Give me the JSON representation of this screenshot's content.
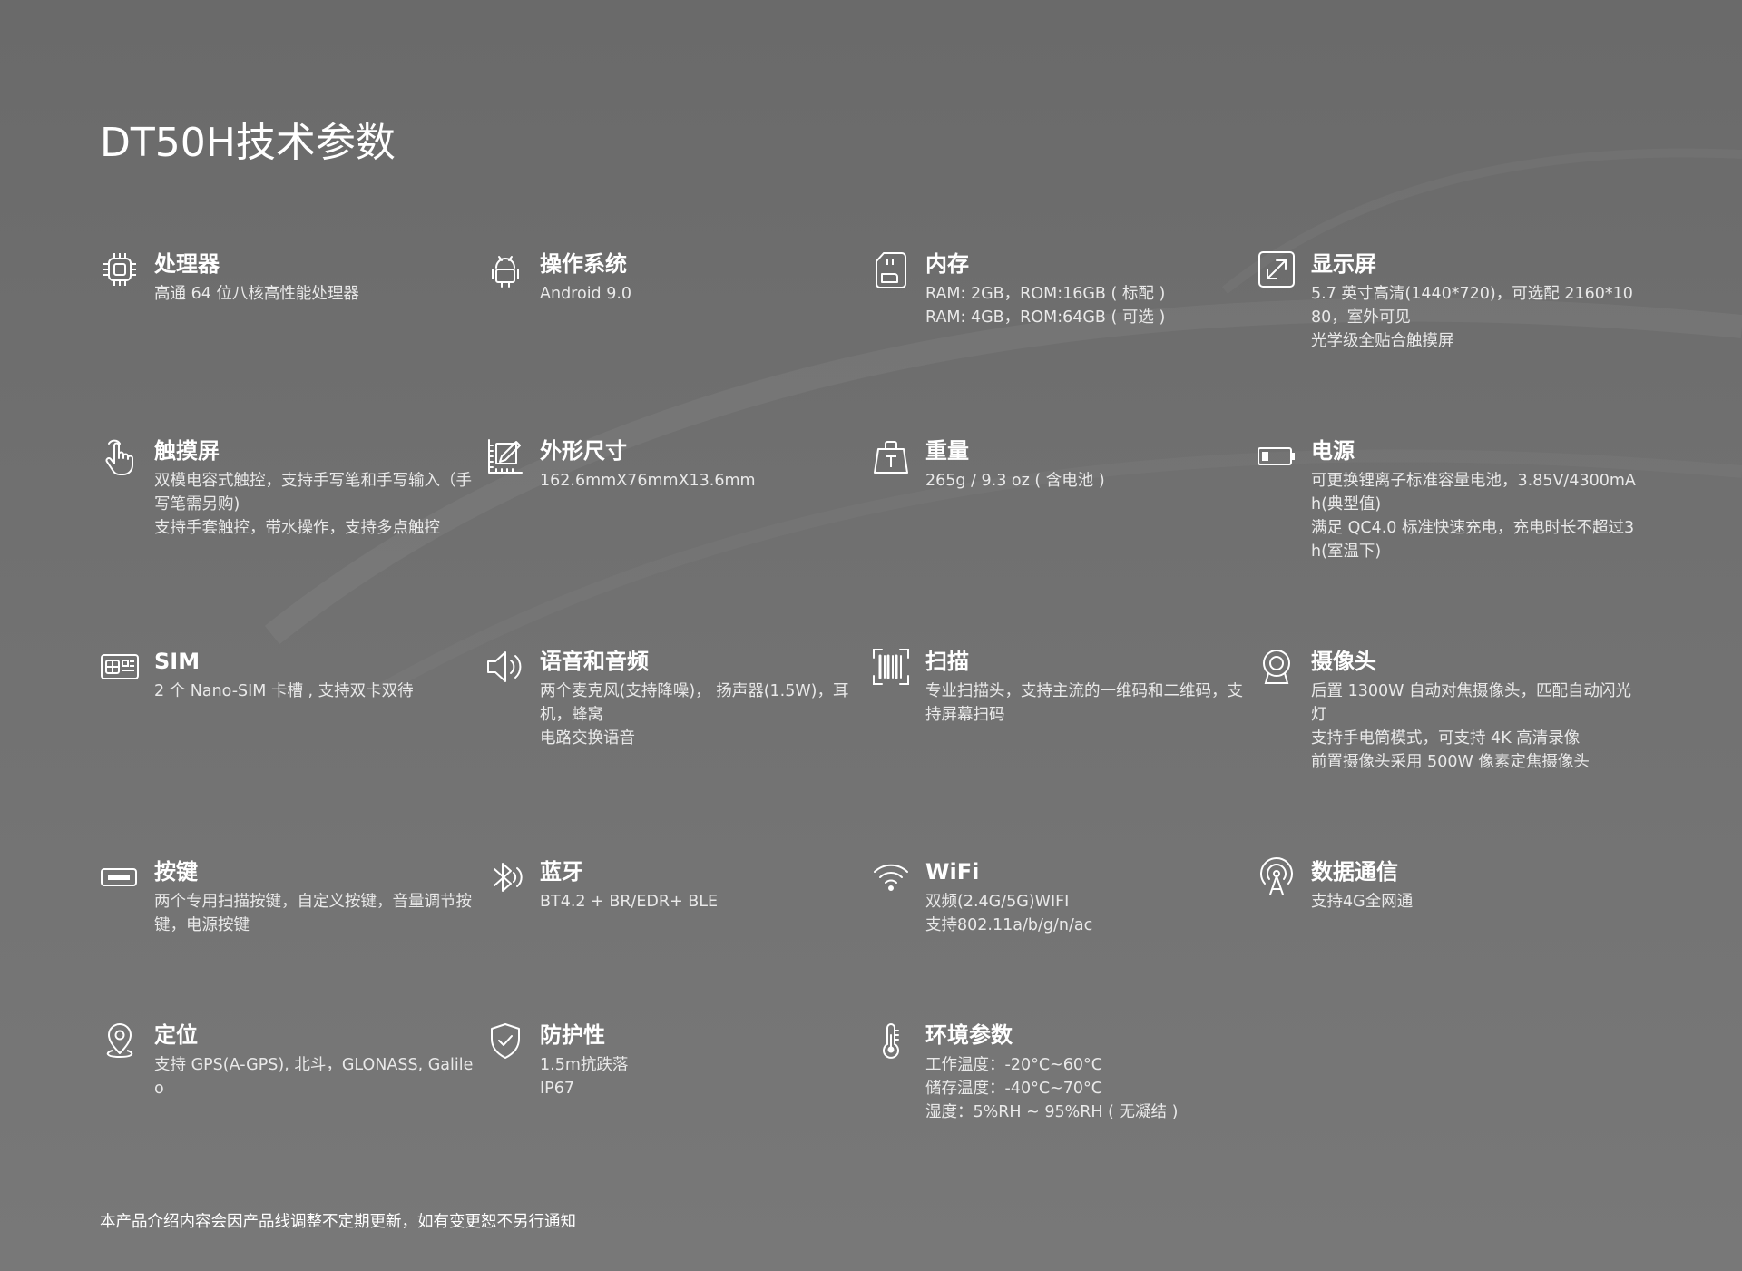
{
  "page": {
    "title": "DT50H技术参数",
    "footer": "本产品介绍内容会因产品线调整不定期更新，如有变更恕不另行通知"
  },
  "specs": [
    {
      "title": "处理器",
      "icon": "chip-icon",
      "lines": [
        "高通 64 位八核高性能处理器"
      ]
    },
    {
      "title": "操作系统",
      "icon": "android-icon",
      "lines": [
        "Android 9.0"
      ]
    },
    {
      "title": "内存",
      "icon": "sd-card-icon",
      "lines": [
        "RAM: 2GB，ROM:16GB ( 标配 )",
        "RAM: 4GB，ROM:64GB ( 可选 )"
      ]
    },
    {
      "title": "显示屏",
      "icon": "expand-screen-icon",
      "lines": [
        "5.7 英寸高清(1440*720)，可选配 2160*1080，室外可见",
        "光学级全贴合触摸屏"
      ]
    },
    {
      "title": "触摸屏",
      "icon": "touch-hand-icon",
      "lines": [
        "双模电容式触控，支持手写笔和手写输入（手写笔需另购)",
        "支持手套触控，带水操作，支持多点触控"
      ]
    },
    {
      "title": "外形尺寸",
      "icon": "ruler-pencil-icon",
      "lines": [
        "162.6mmX76mmX13.6mm"
      ]
    },
    {
      "title": "重量",
      "icon": "weight-icon",
      "lines": [
        "265g / 9.3 oz ( 含电池 )"
      ]
    },
    {
      "title": "电源",
      "icon": "battery-icon",
      "lines": [
        "可更换锂离子标准容量电池，3.85V/4300mAh(典型值)",
        "满足 QC4.0 标准快速充电，充电时长不超过3h(室温下)"
      ]
    },
    {
      "title": "SIM",
      "icon": "sim-card-icon",
      "lines": [
        "2 个 Nano-SIM 卡槽 , 支持双卡双待"
      ]
    },
    {
      "title": "语音和音频",
      "icon": "speaker-icon",
      "lines": [
        "两个麦克风(支持降噪)， 扬声器(1.5W)，耳机，蜂窝",
        "电路交换语音"
      ]
    },
    {
      "title": "扫描",
      "icon": "barcode-scan-icon",
      "lines": [
        "专业扫描头，支持主流的一维码和二维码，支持屏幕扫码"
      ]
    },
    {
      "title": "摄像头",
      "icon": "camera-icon",
      "lines": [
        "后置 1300W 自动对焦摄像头，匹配自动闪光灯",
        "支持手电筒模式，可支持 4K 高清录像",
        "前置摄像头采用 500W 像素定焦摄像头"
      ]
    },
    {
      "title": "按键",
      "icon": "key-button-icon",
      "lines": [
        "两个专用扫描按键，自定义按键，音量调节按键，电源按键"
      ]
    },
    {
      "title": "蓝牙",
      "icon": "bluetooth-icon",
      "lines": [
        "BT4.2 + BR/EDR+ BLE"
      ]
    },
    {
      "title": "WiFi",
      "icon": "wifi-icon",
      "lines": [
        "双频(2.4G/5G)WIFI",
        "支持802.11a/b/g/n/ac"
      ]
    },
    {
      "title": "数据通信",
      "icon": "signal-tower-icon",
      "lines": [
        "支持4G全网通"
      ]
    },
    {
      "title": "定位",
      "icon": "location-pin-icon",
      "lines": [
        "支持 GPS(A-GPS), 北斗，GLONASS, Galileo"
      ]
    },
    {
      "title": "防护性",
      "icon": "shield-icon",
      "lines": [
        "1.5m抗跌落",
        "IP67"
      ]
    },
    {
      "title": "环境参数",
      "icon": "thermometer-icon",
      "lines": [
        "工作温度：-20°C~60°C",
        "储存温度：-40°C~70°C",
        "湿度：5%RH ~ 95%RH ( 无凝结 )"
      ]
    }
  ]
}
